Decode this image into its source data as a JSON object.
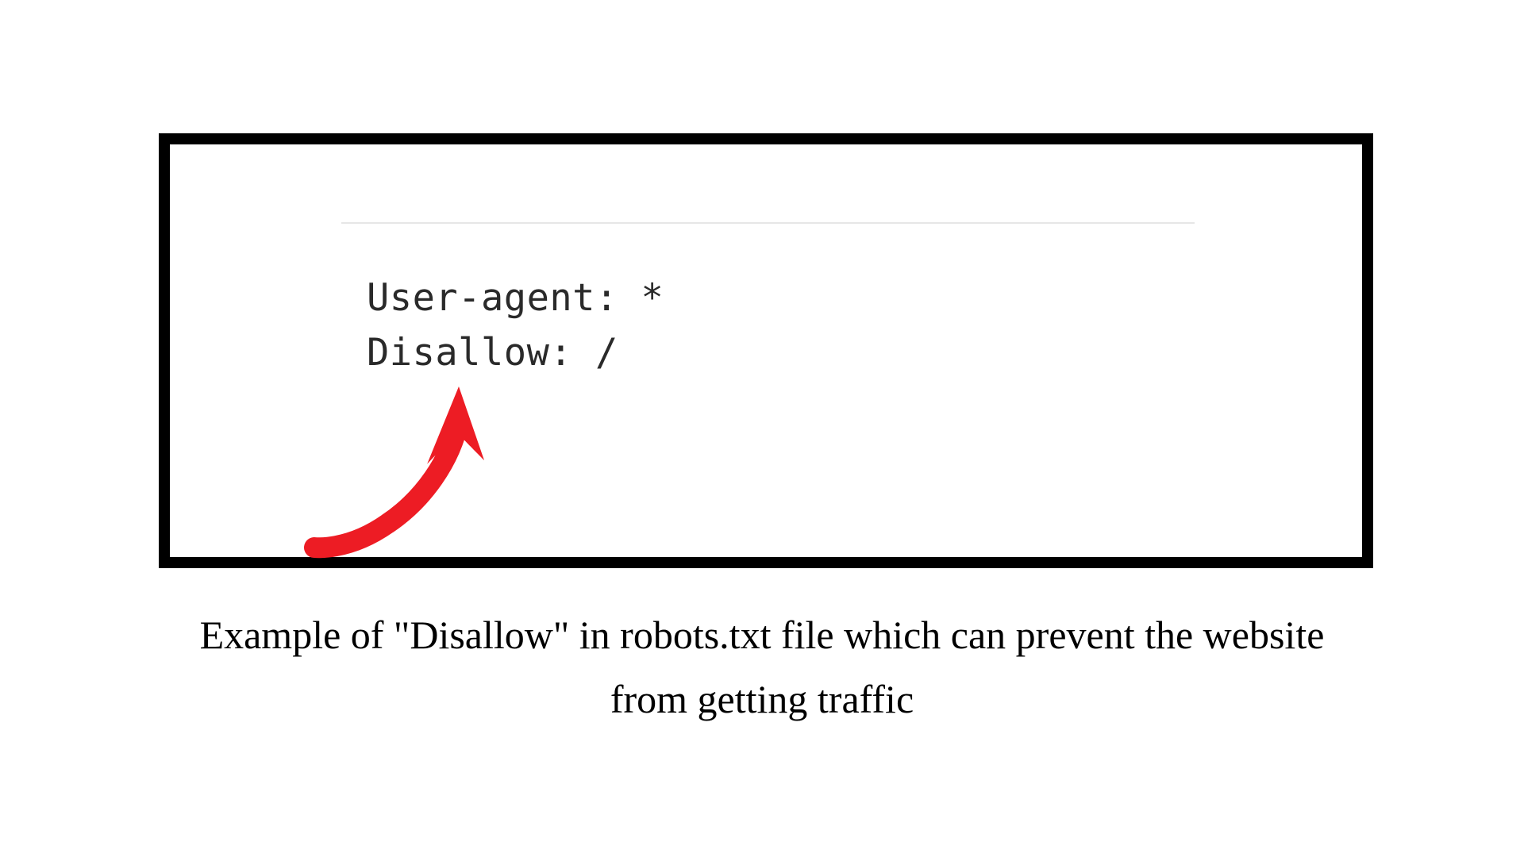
{
  "code": {
    "line1": "User-agent: *",
    "line2": "Disallow: /"
  },
  "caption": "Example of \"Disallow\" in robots.txt file which can prevent the website from getting traffic",
  "colors": {
    "arrow": "#ed1c24",
    "border": "#000000",
    "rule": "#e6e6e6"
  }
}
